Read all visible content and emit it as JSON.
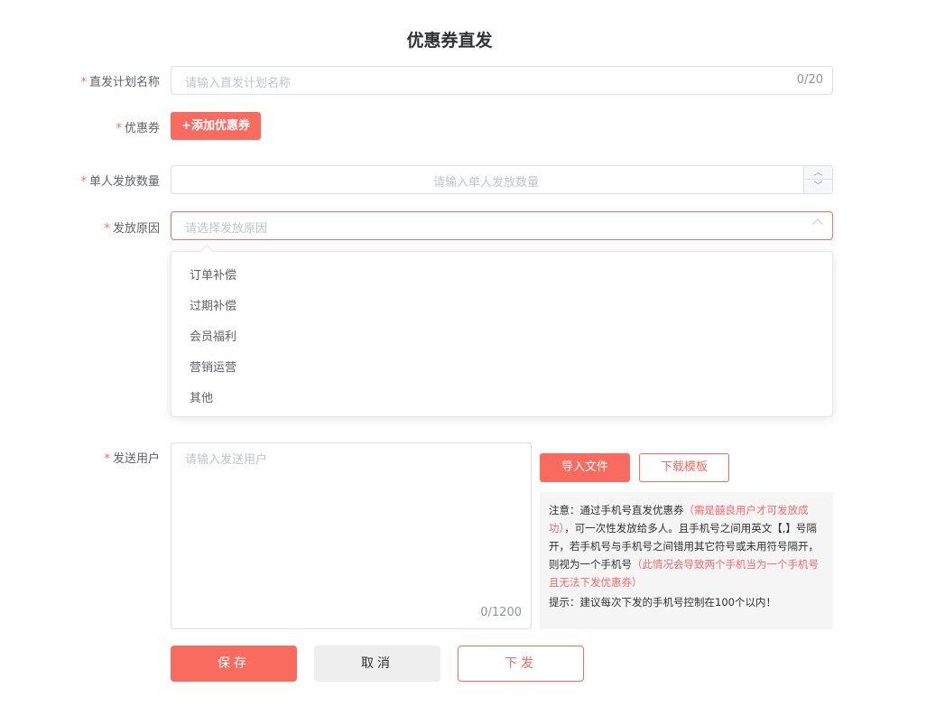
{
  "page": {
    "title": "优惠券直发"
  },
  "colors": {
    "accent": "#fa6b5f",
    "required": "#f56c6c",
    "placeholder": "#c0c4cc",
    "notice_bg": "#f5f5f5"
  },
  "form": {
    "required_mark": "*",
    "plan_name": {
      "label": "直发计划名称",
      "placeholder": "请输入直发计划名称",
      "count": "0/20"
    },
    "coupon": {
      "label": "优惠券",
      "add_button": "+添加优惠券"
    },
    "per_user_qty": {
      "label": "单人发放数量",
      "placeholder": "请输入单人发放数量",
      "up_icon": "chevron-up-icon",
      "down_icon": "chevron-down-icon"
    },
    "reason": {
      "label": "发放原因",
      "placeholder": "请选择发放原因",
      "options": [
        "订单补偿",
        "过期补偿",
        "会员福利",
        "营销运营",
        "其他"
      ]
    },
    "send_users": {
      "label": "发送用户",
      "placeholder": "请输入发送用户",
      "count": "0/1200",
      "import_button": "导入文件",
      "download_button": "下载模板",
      "notice": {
        "p1": "注意：通过手机号直发优惠券",
        "p1_red": "（需是囍良用户才可发放成功）",
        "p2": "，可一次性发放给多人。且手机号之间用英文【,】号隔开，若手机号与手机号之间错用其它符号或未用符号隔开，则视为一个手机号",
        "p2_red": "（此情况会导致两个手机当为一个手机号且无法下发优惠券）",
        "tip": "提示：建议每次下发的手机号控制在100个以内！"
      }
    }
  },
  "actions": {
    "save": "保存",
    "cancel": "取消",
    "send": "下发"
  }
}
